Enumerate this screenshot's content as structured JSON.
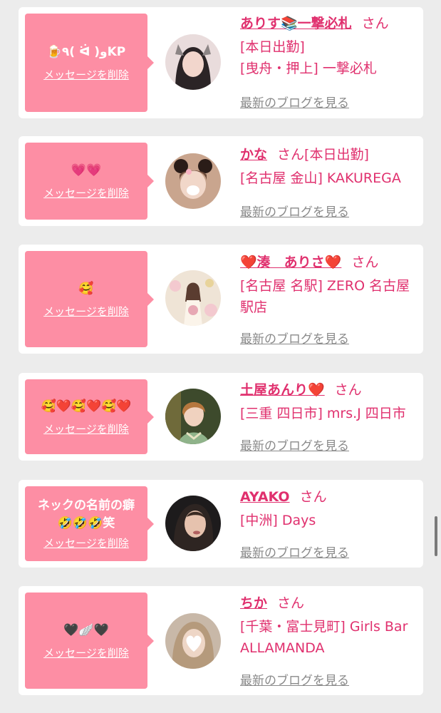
{
  "delete_label": "メッセージを削除",
  "blog_label": "最新のブログを見る",
  "san_label": "さん",
  "colors": {
    "bubble": "#fd8ea4",
    "accent": "#e0306e",
    "muted": "#8a8a8a"
  },
  "entries": [
    {
      "message": "🍺٩( ᐛ )وKP",
      "name": "ありす📚一撃必札",
      "lines": [
        "[本日出勤]",
        "[曳舟・押上] 一撃必札"
      ]
    },
    {
      "message": "💗💗",
      "name": "かな",
      "lines": [
        "[本日出勤]",
        "[名古屋 金山] KAKUREGA"
      ]
    },
    {
      "message": "🥰",
      "name": "❤️湊　ありさ❤️",
      "lines": [
        "[名古屋 名駅] ZERO 名古屋駅店"
      ]
    },
    {
      "message": "🥰❤️🥰❤️🥰❤️",
      "name": "土屋あんり❤️",
      "lines": [
        "[三重 四日市] mrs.J 四日市"
      ]
    },
    {
      "message": "ネックの名前の癖\n🤣🤣🤣笑",
      "name": "AYAKO",
      "lines": [
        "[中洲] Days"
      ]
    },
    {
      "message": "🖤🪽🖤",
      "name": "ちか",
      "lines": [
        "[千葉・富士見町] Girls Bar ALLAMANDA"
      ]
    }
  ]
}
